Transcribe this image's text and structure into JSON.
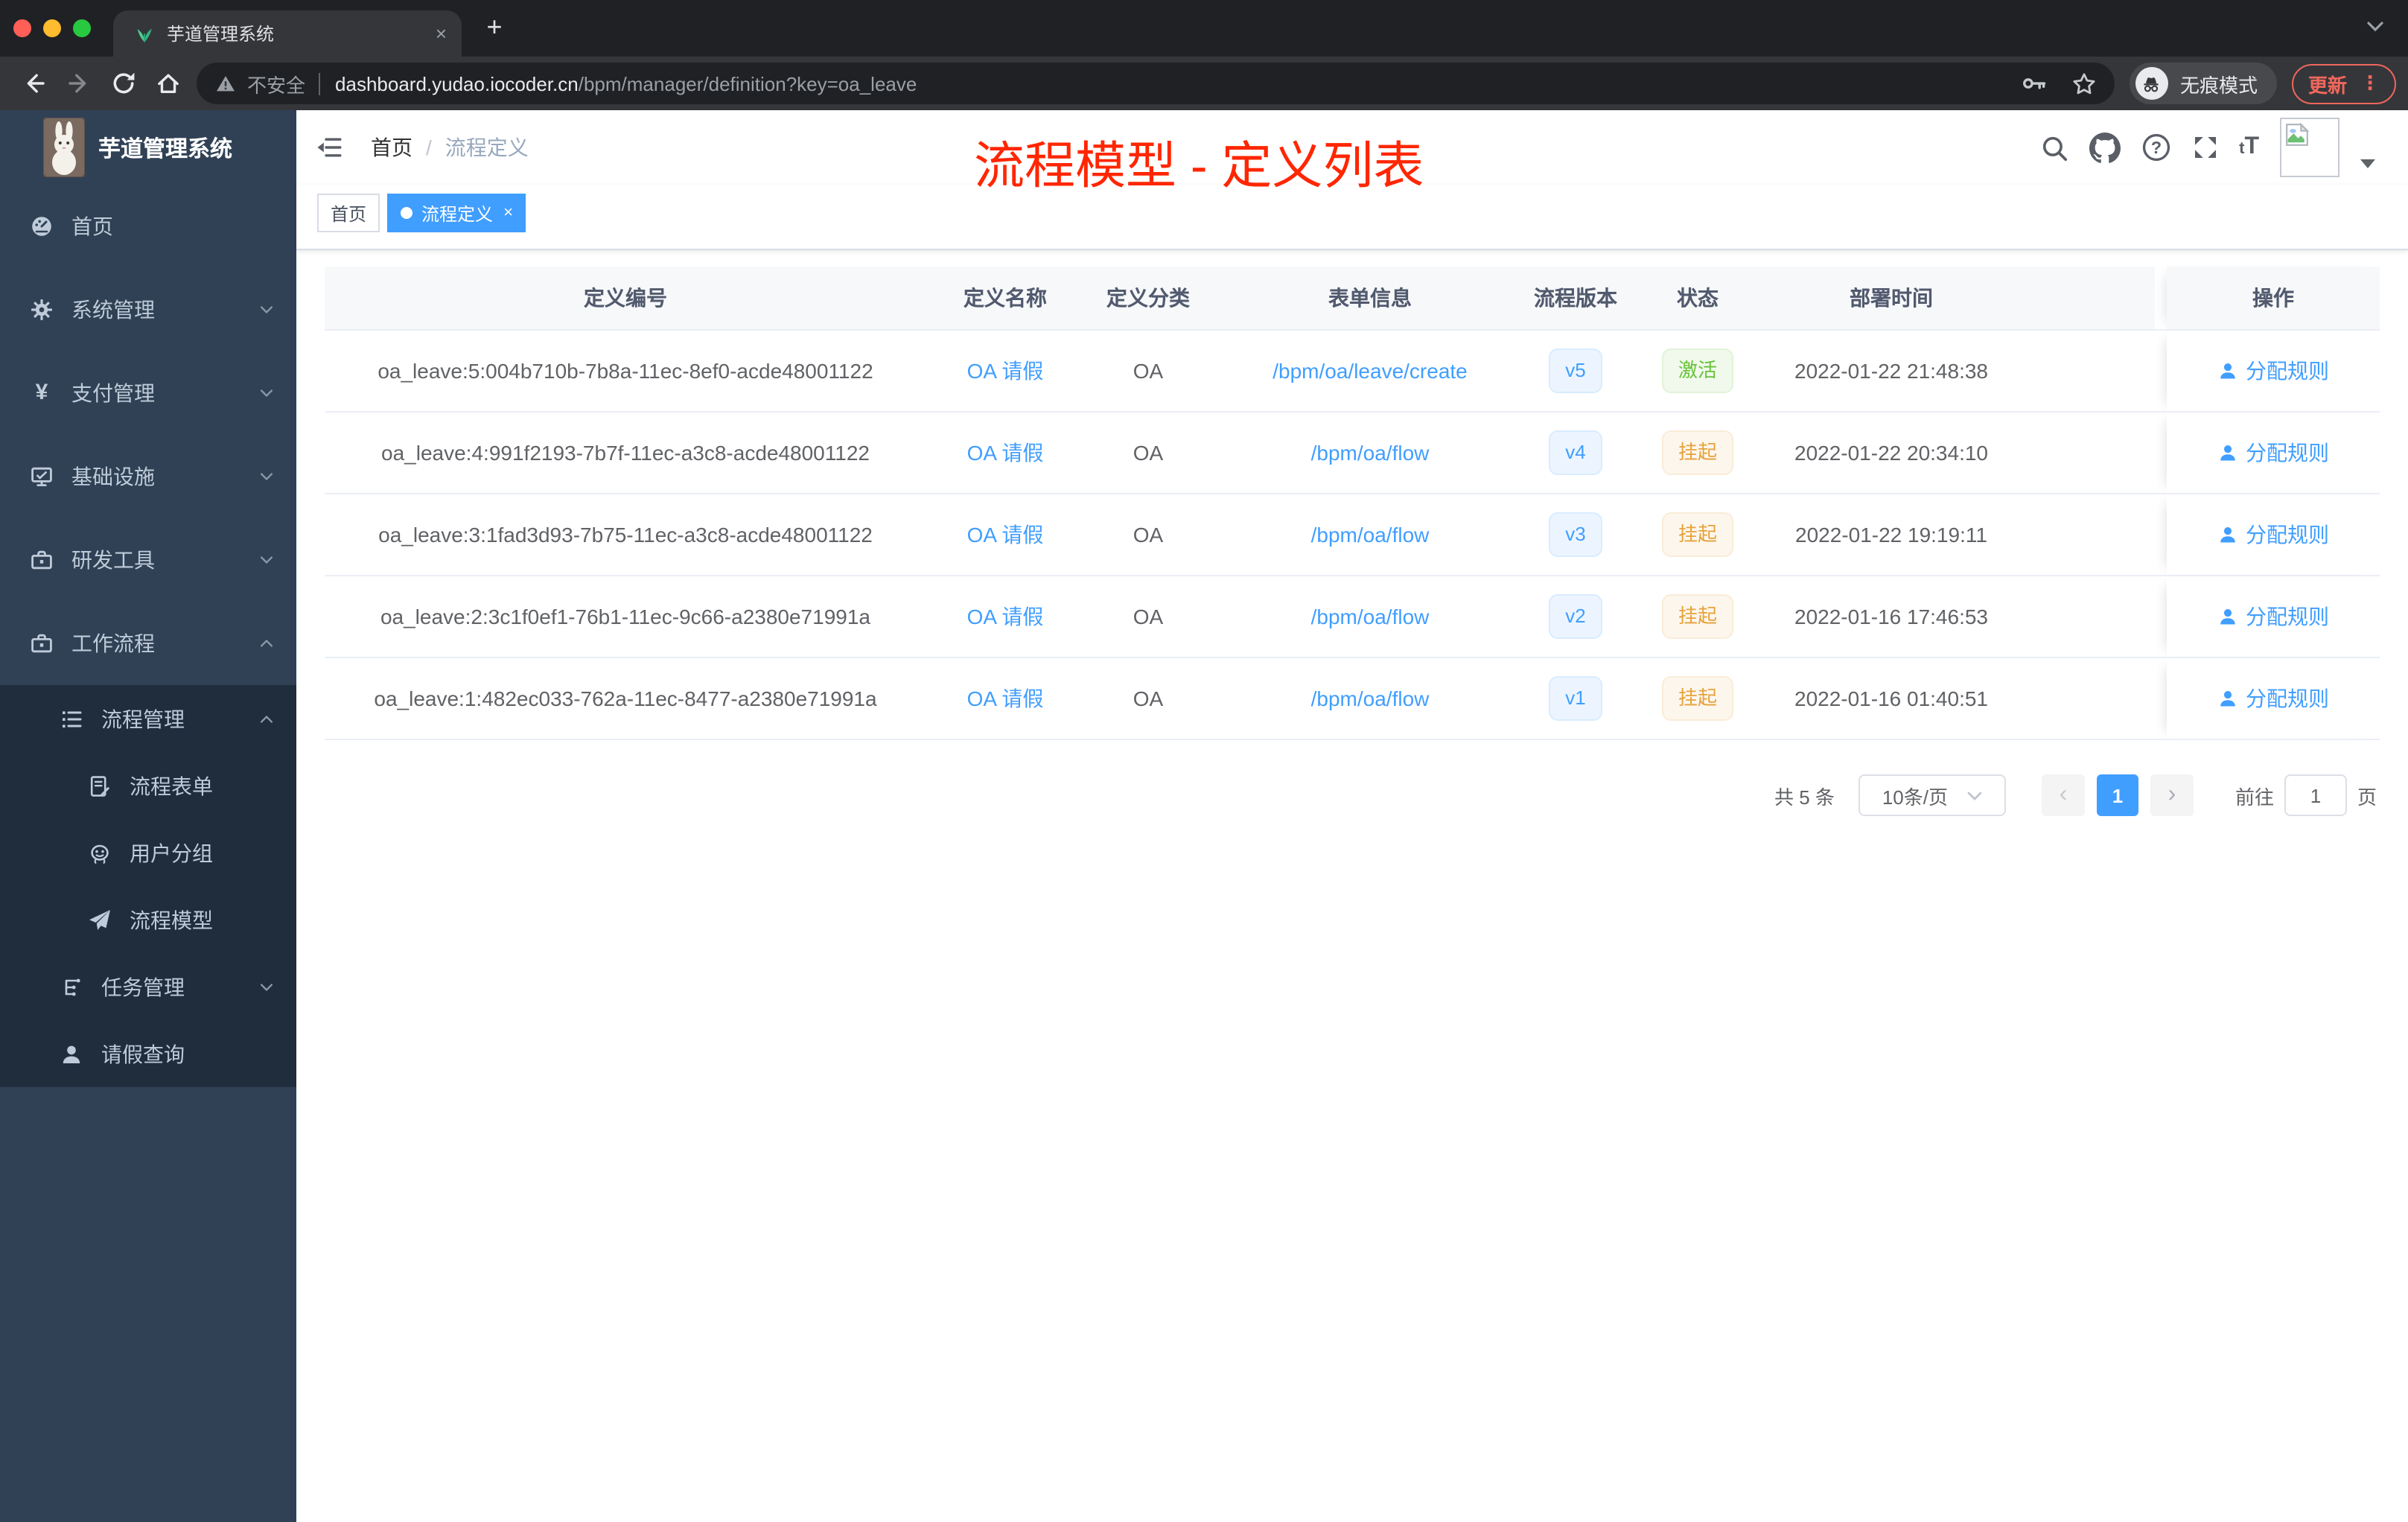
{
  "colors": {
    "accent": "#409eff",
    "annotation_red": "#ff2600",
    "success_green": "#67c23a",
    "warning_orange": "#e6a23c",
    "sidebar_bg": "#304156",
    "sidebar_submenu_bg": "#1f2d3d"
  },
  "icons": {
    "close": "×",
    "new_tab": "+",
    "more_vertical": "⋮",
    "page_prev": "‹",
    "page_next": "›"
  },
  "browser": {
    "tab_title": "芋道管理系统",
    "security_label": "不安全",
    "url_host": "dashboard.yudao.iocoder.cn",
    "url_path": "/bpm/manager/definition?key=oa_leave",
    "incognito_label": "无痕模式",
    "update_label": "更新"
  },
  "sidebar": {
    "brand": "芋道管理系统",
    "items": [
      {
        "label": "首页",
        "icon": "dashboard-icon"
      },
      {
        "label": "系统管理",
        "icon": "gear-icon"
      },
      {
        "label": "支付管理",
        "icon": "yen-icon"
      },
      {
        "label": "基础设施",
        "icon": "monitor-icon"
      },
      {
        "label": "研发工具",
        "icon": "toolbox-icon"
      },
      {
        "label": "工作流程",
        "icon": "briefcase-icon"
      },
      {
        "label": "流程管理",
        "icon": "list-icon"
      },
      {
        "label": "流程表单",
        "icon": "form-icon"
      },
      {
        "label": "用户分组",
        "icon": "robot-icon"
      },
      {
        "label": "流程模型",
        "icon": "paper-plane-icon"
      },
      {
        "label": "任务管理",
        "icon": "flow-icon"
      },
      {
        "label": "请假查询",
        "icon": "user-icon"
      }
    ]
  },
  "navbar": {
    "breadcrumb": [
      "首页",
      "流程定义"
    ]
  },
  "tags_view": {
    "tabs": [
      {
        "label": "首页"
      },
      {
        "label": "流程定义"
      }
    ]
  },
  "annotation": {
    "text": "流程模型 - 定义列表"
  },
  "table": {
    "headers": {
      "id": "定义编号",
      "name": "定义名称",
      "category": "定义分类",
      "form": "表单信息",
      "version": "流程版本",
      "status": "状态",
      "deployed": "部署时间",
      "action": "操作"
    },
    "rows": [
      {
        "id": "oa_leave:5:004b710b-7b8a-11ec-8ef0-acde48001122",
        "name": "OA 请假",
        "category": "OA",
        "form": "/bpm/oa/leave/create",
        "version": "v5",
        "status": "激活",
        "status_type": "success",
        "deployed": "2022-01-22 21:48:38",
        "action": "分配规则"
      },
      {
        "id": "oa_leave:4:991f2193-7b7f-11ec-a3c8-acde48001122",
        "name": "OA 请假",
        "category": "OA",
        "form": "/bpm/oa/flow",
        "version": "v4",
        "status": "挂起",
        "status_type": "warning",
        "deployed": "2022-01-22 20:34:10",
        "action": "分配规则"
      },
      {
        "id": "oa_leave:3:1fad3d93-7b75-11ec-a3c8-acde48001122",
        "name": "OA 请假",
        "category": "OA",
        "form": "/bpm/oa/flow",
        "version": "v3",
        "status": "挂起",
        "status_type": "warning",
        "deployed": "2022-01-22 19:19:11",
        "action": "分配规则"
      },
      {
        "id": "oa_leave:2:3c1f0ef1-76b1-11ec-9c66-a2380e71991a",
        "name": "OA 请假",
        "category": "OA",
        "form": "/bpm/oa/flow",
        "version": "v2",
        "status": "挂起",
        "status_type": "warning",
        "deployed": "2022-01-16 17:46:53",
        "action": "分配规则"
      },
      {
        "id": "oa_leave:1:482ec033-762a-11ec-8477-a2380e71991a",
        "name": "OA 请假",
        "category": "OA",
        "form": "/bpm/oa/flow",
        "version": "v1",
        "status": "挂起",
        "status_type": "warning",
        "deployed": "2022-01-16 01:40:51",
        "action": "分配规则"
      }
    ]
  },
  "pagination": {
    "total": "共 5 条",
    "page_size": "10条/页",
    "current": "1",
    "goto_label": "前往",
    "goto_value": "1",
    "goto_unit": "页"
  }
}
